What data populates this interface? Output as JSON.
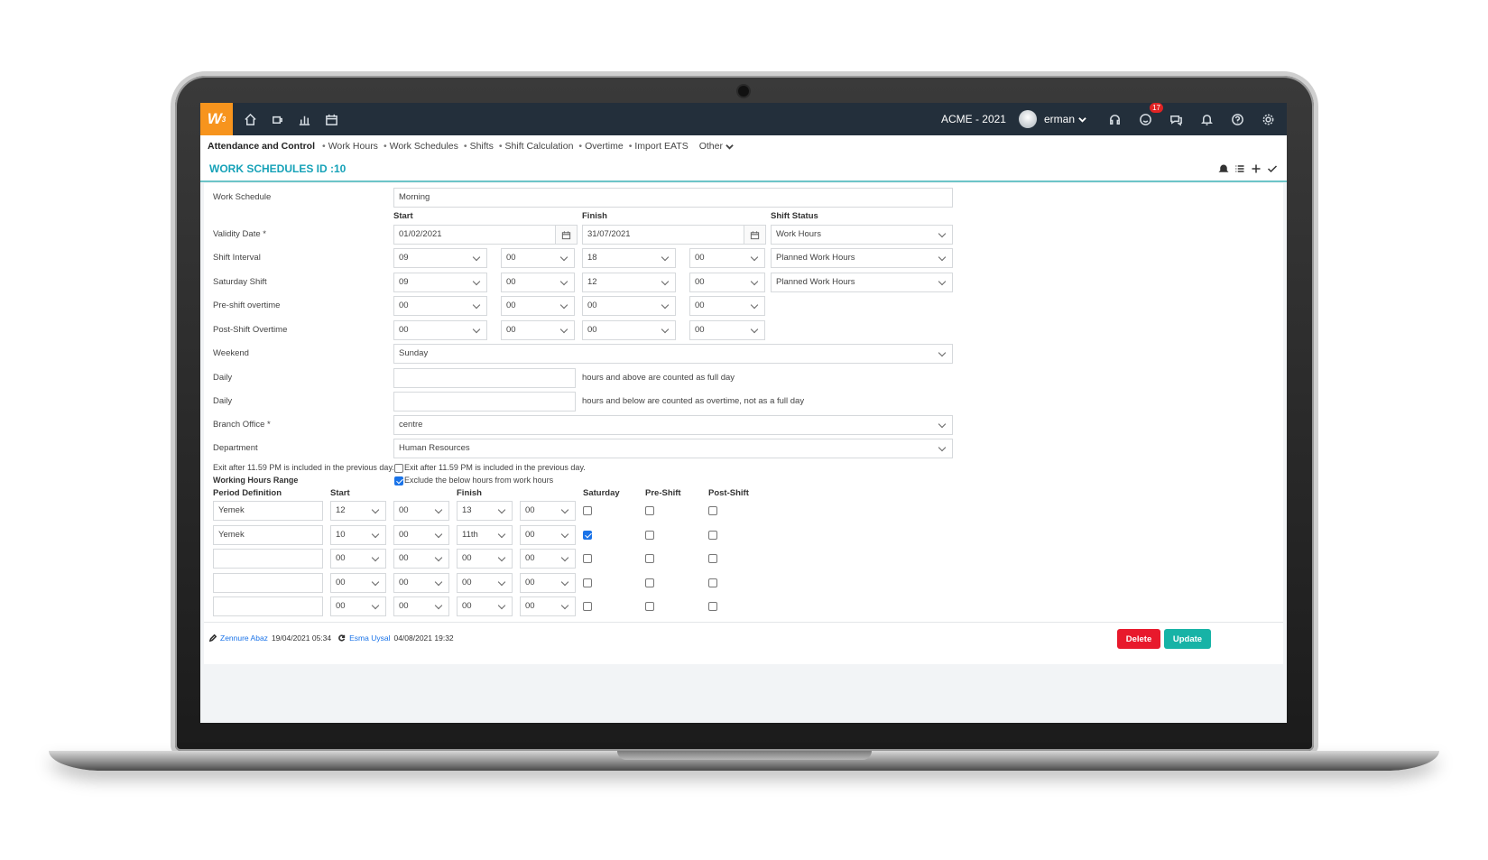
{
  "topbar": {
    "logo": "W",
    "logo_sup": "3",
    "company": "ACME - 2021",
    "username": "erman",
    "notification_count": "17"
  },
  "nav": {
    "main": "Attendance and Control",
    "items": [
      "Work Hours",
      "Work Schedules",
      "Shifts",
      "Shift Calculation",
      "Overtime",
      "Import EATS"
    ],
    "other": "Other"
  },
  "page": {
    "title": "WORK SCHEDULES ID :10"
  },
  "form": {
    "work_schedule_label": "Work Schedule",
    "work_schedule_value": "Morning",
    "col_start": "Start",
    "col_finish": "Finish",
    "col_shift_status": "Shift Status",
    "validity_label": "Validity Date *",
    "validity_start": "01/02/2021",
    "validity_finish": "31/07/2021",
    "validity_status": "Work Hours",
    "shift_interval_label": "Shift Interval",
    "shift_interval": [
      "09",
      "00",
      "18",
      "00"
    ],
    "shift_interval_status": "Planned Work Hours",
    "saturday_label": "Saturday Shift",
    "saturday": [
      "09",
      "00",
      "12",
      "00"
    ],
    "saturday_status": "Planned Work Hours",
    "pre_label": "Pre-shift overtime",
    "pre": [
      "00",
      "00",
      "00",
      "00"
    ],
    "post_label": "Post-Shift Overtime",
    "post": [
      "00",
      "00",
      "00",
      "00"
    ],
    "weekend_label": "Weekend",
    "weekend_value": "Sunday",
    "daily1_label": "Daily",
    "daily1_text": "hours and above are counted as full day",
    "daily2_label": "Daily",
    "daily2_text": "hours and below are counted as overtime, not as a full day",
    "branch_label": "Branch Office *",
    "branch_value": "centre",
    "department_label": "Department",
    "department_value": "Human Resources",
    "exit_label": "Exit after 11.59 PM is included in the previous day.",
    "exit_cb_text": "Exit after 11.59 PM is included in the previous day.",
    "range_label": "Working Hours Range",
    "exclude_cb_text": "Exclude the below hours from work hours"
  },
  "periods": {
    "headers": {
      "definition": "Period Definition",
      "start": "Start",
      "finish": "Finish",
      "saturday": "Saturday",
      "pre": "Pre-Shift",
      "post": "Post-Shift"
    },
    "rows": [
      {
        "name": "Yemek",
        "sh": "12",
        "sm": "00",
        "fh": "13",
        "fm": "00",
        "sat": false,
        "pre": false,
        "post": false
      },
      {
        "name": "Yemek",
        "sh": "10",
        "sm": "00",
        "fh": "11th",
        "fm": "00",
        "sat": true,
        "pre": false,
        "post": false
      },
      {
        "name": "",
        "sh": "00",
        "sm": "00",
        "fh": "00",
        "fm": "00",
        "sat": false,
        "pre": false,
        "post": false
      },
      {
        "name": "",
        "sh": "00",
        "sm": "00",
        "fh": "00",
        "fm": "00",
        "sat": false,
        "pre": false,
        "post": false
      },
      {
        "name": "",
        "sh": "00",
        "sm": "00",
        "fh": "00",
        "fm": "00",
        "sat": false,
        "pre": false,
        "post": false
      }
    ]
  },
  "footer": {
    "created_by": "Zennure Abaz",
    "created_at": "19/04/2021 05:34",
    "updated_by": "Esma Uysal",
    "updated_at": "04/08/2021 19:32",
    "delete_label": "Delete",
    "update_label": "Update"
  },
  "colors": {
    "accent": "#17a2b8",
    "logo": "#f7941d",
    "delete": "#e8192c",
    "update": "#17b3a6",
    "topbar": "#232f3b"
  }
}
